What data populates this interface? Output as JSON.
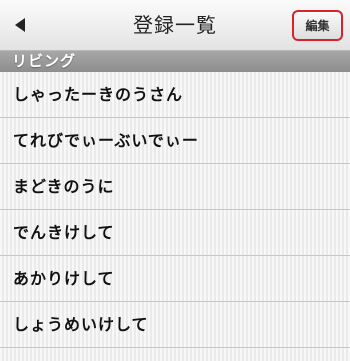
{
  "navbar": {
    "back_icon": "left-triangle",
    "title": "登録一覧",
    "edit_label": "編集",
    "edit_highlight_color": "#d9232c"
  },
  "section": {
    "header": "リビング",
    "items": [
      {
        "label": "しゃったーきのうさん"
      },
      {
        "label": "てれびでぃーぶいでぃー"
      },
      {
        "label": "まどきのうに"
      },
      {
        "label": "でんきけして"
      },
      {
        "label": "あかりけして"
      },
      {
        "label": "しょうめいけして"
      }
    ]
  }
}
